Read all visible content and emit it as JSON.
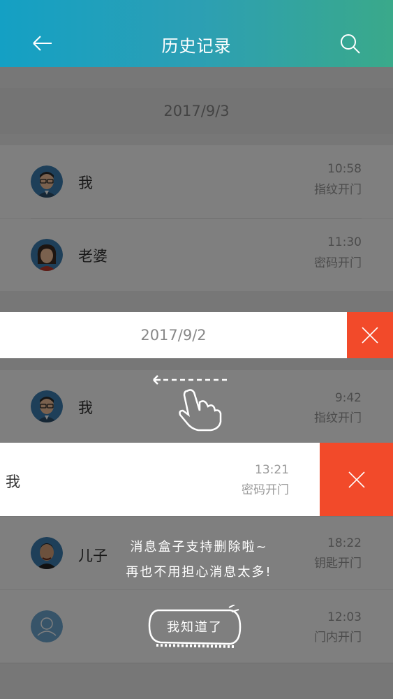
{
  "header": {
    "title": "历史记录",
    "back_icon": "arrow-left-icon",
    "search_icon": "search-icon"
  },
  "groups": [
    {
      "date": "2017/9/3",
      "records": [
        {
          "name": "我",
          "time": "10:58",
          "method": "指纹开门",
          "avatar": "avatar-man-glasses"
        },
        {
          "name": "老婆",
          "time": "11:30",
          "method": "密码开门",
          "avatar": "avatar-woman"
        }
      ]
    },
    {
      "date": "2017/9/2",
      "records": [
        {
          "name": "我",
          "time": "9:42",
          "method": "指纹开门",
          "avatar": "avatar-man-glasses"
        },
        {
          "name": "我",
          "time": "13:21",
          "method": "密码开门",
          "avatar": "avatar-man-glasses"
        },
        {
          "name": "儿子",
          "time": "18:22",
          "method": "钥匙开门",
          "avatar": "avatar-boy"
        },
        {
          "name": "",
          "time": "12:03",
          "method": "门内开门",
          "avatar": "avatar-default"
        }
      ]
    }
  ],
  "tip": {
    "line1": "消息盒子支持删除啦~",
    "line2": "再也不用担心消息太多!",
    "button": "我知道了"
  },
  "colors": {
    "delete": "#f24a2a",
    "header_start": "#14a0c4",
    "header_end": "#3aa98a"
  }
}
